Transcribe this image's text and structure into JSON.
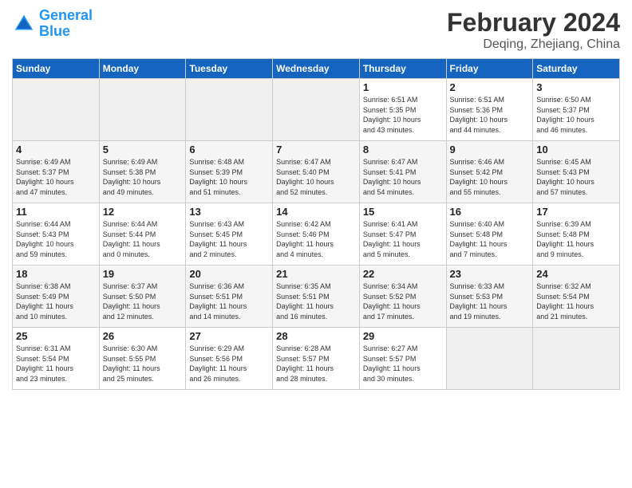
{
  "header": {
    "logo_line1": "General",
    "logo_line2": "Blue",
    "month": "February 2024",
    "location": "Deqing, Zhejiang, China"
  },
  "days_of_week": [
    "Sunday",
    "Monday",
    "Tuesday",
    "Wednesday",
    "Thursday",
    "Friday",
    "Saturday"
  ],
  "weeks": [
    [
      {
        "day": "",
        "info": ""
      },
      {
        "day": "",
        "info": ""
      },
      {
        "day": "",
        "info": ""
      },
      {
        "day": "",
        "info": ""
      },
      {
        "day": "1",
        "info": "Sunrise: 6:51 AM\nSunset: 5:35 PM\nDaylight: 10 hours\nand 43 minutes."
      },
      {
        "day": "2",
        "info": "Sunrise: 6:51 AM\nSunset: 5:36 PM\nDaylight: 10 hours\nand 44 minutes."
      },
      {
        "day": "3",
        "info": "Sunrise: 6:50 AM\nSunset: 5:37 PM\nDaylight: 10 hours\nand 46 minutes."
      }
    ],
    [
      {
        "day": "4",
        "info": "Sunrise: 6:49 AM\nSunset: 5:37 PM\nDaylight: 10 hours\nand 47 minutes."
      },
      {
        "day": "5",
        "info": "Sunrise: 6:49 AM\nSunset: 5:38 PM\nDaylight: 10 hours\nand 49 minutes."
      },
      {
        "day": "6",
        "info": "Sunrise: 6:48 AM\nSunset: 5:39 PM\nDaylight: 10 hours\nand 51 minutes."
      },
      {
        "day": "7",
        "info": "Sunrise: 6:47 AM\nSunset: 5:40 PM\nDaylight: 10 hours\nand 52 minutes."
      },
      {
        "day": "8",
        "info": "Sunrise: 6:47 AM\nSunset: 5:41 PM\nDaylight: 10 hours\nand 54 minutes."
      },
      {
        "day": "9",
        "info": "Sunrise: 6:46 AM\nSunset: 5:42 PM\nDaylight: 10 hours\nand 55 minutes."
      },
      {
        "day": "10",
        "info": "Sunrise: 6:45 AM\nSunset: 5:43 PM\nDaylight: 10 hours\nand 57 minutes."
      }
    ],
    [
      {
        "day": "11",
        "info": "Sunrise: 6:44 AM\nSunset: 5:43 PM\nDaylight: 10 hours\nand 59 minutes."
      },
      {
        "day": "12",
        "info": "Sunrise: 6:44 AM\nSunset: 5:44 PM\nDaylight: 11 hours\nand 0 minutes."
      },
      {
        "day": "13",
        "info": "Sunrise: 6:43 AM\nSunset: 5:45 PM\nDaylight: 11 hours\nand 2 minutes."
      },
      {
        "day": "14",
        "info": "Sunrise: 6:42 AM\nSunset: 5:46 PM\nDaylight: 11 hours\nand 4 minutes."
      },
      {
        "day": "15",
        "info": "Sunrise: 6:41 AM\nSunset: 5:47 PM\nDaylight: 11 hours\nand 5 minutes."
      },
      {
        "day": "16",
        "info": "Sunrise: 6:40 AM\nSunset: 5:48 PM\nDaylight: 11 hours\nand 7 minutes."
      },
      {
        "day": "17",
        "info": "Sunrise: 6:39 AM\nSunset: 5:48 PM\nDaylight: 11 hours\nand 9 minutes."
      }
    ],
    [
      {
        "day": "18",
        "info": "Sunrise: 6:38 AM\nSunset: 5:49 PM\nDaylight: 11 hours\nand 10 minutes."
      },
      {
        "day": "19",
        "info": "Sunrise: 6:37 AM\nSunset: 5:50 PM\nDaylight: 11 hours\nand 12 minutes."
      },
      {
        "day": "20",
        "info": "Sunrise: 6:36 AM\nSunset: 5:51 PM\nDaylight: 11 hours\nand 14 minutes."
      },
      {
        "day": "21",
        "info": "Sunrise: 6:35 AM\nSunset: 5:51 PM\nDaylight: 11 hours\nand 16 minutes."
      },
      {
        "day": "22",
        "info": "Sunrise: 6:34 AM\nSunset: 5:52 PM\nDaylight: 11 hours\nand 17 minutes."
      },
      {
        "day": "23",
        "info": "Sunrise: 6:33 AM\nSunset: 5:53 PM\nDaylight: 11 hours\nand 19 minutes."
      },
      {
        "day": "24",
        "info": "Sunrise: 6:32 AM\nSunset: 5:54 PM\nDaylight: 11 hours\nand 21 minutes."
      }
    ],
    [
      {
        "day": "25",
        "info": "Sunrise: 6:31 AM\nSunset: 5:54 PM\nDaylight: 11 hours\nand 23 minutes."
      },
      {
        "day": "26",
        "info": "Sunrise: 6:30 AM\nSunset: 5:55 PM\nDaylight: 11 hours\nand 25 minutes."
      },
      {
        "day": "27",
        "info": "Sunrise: 6:29 AM\nSunset: 5:56 PM\nDaylight: 11 hours\nand 26 minutes."
      },
      {
        "day": "28",
        "info": "Sunrise: 6:28 AM\nSunset: 5:57 PM\nDaylight: 11 hours\nand 28 minutes."
      },
      {
        "day": "29",
        "info": "Sunrise: 6:27 AM\nSunset: 5:57 PM\nDaylight: 11 hours\nand 30 minutes."
      },
      {
        "day": "",
        "info": ""
      },
      {
        "day": "",
        "info": ""
      }
    ]
  ]
}
